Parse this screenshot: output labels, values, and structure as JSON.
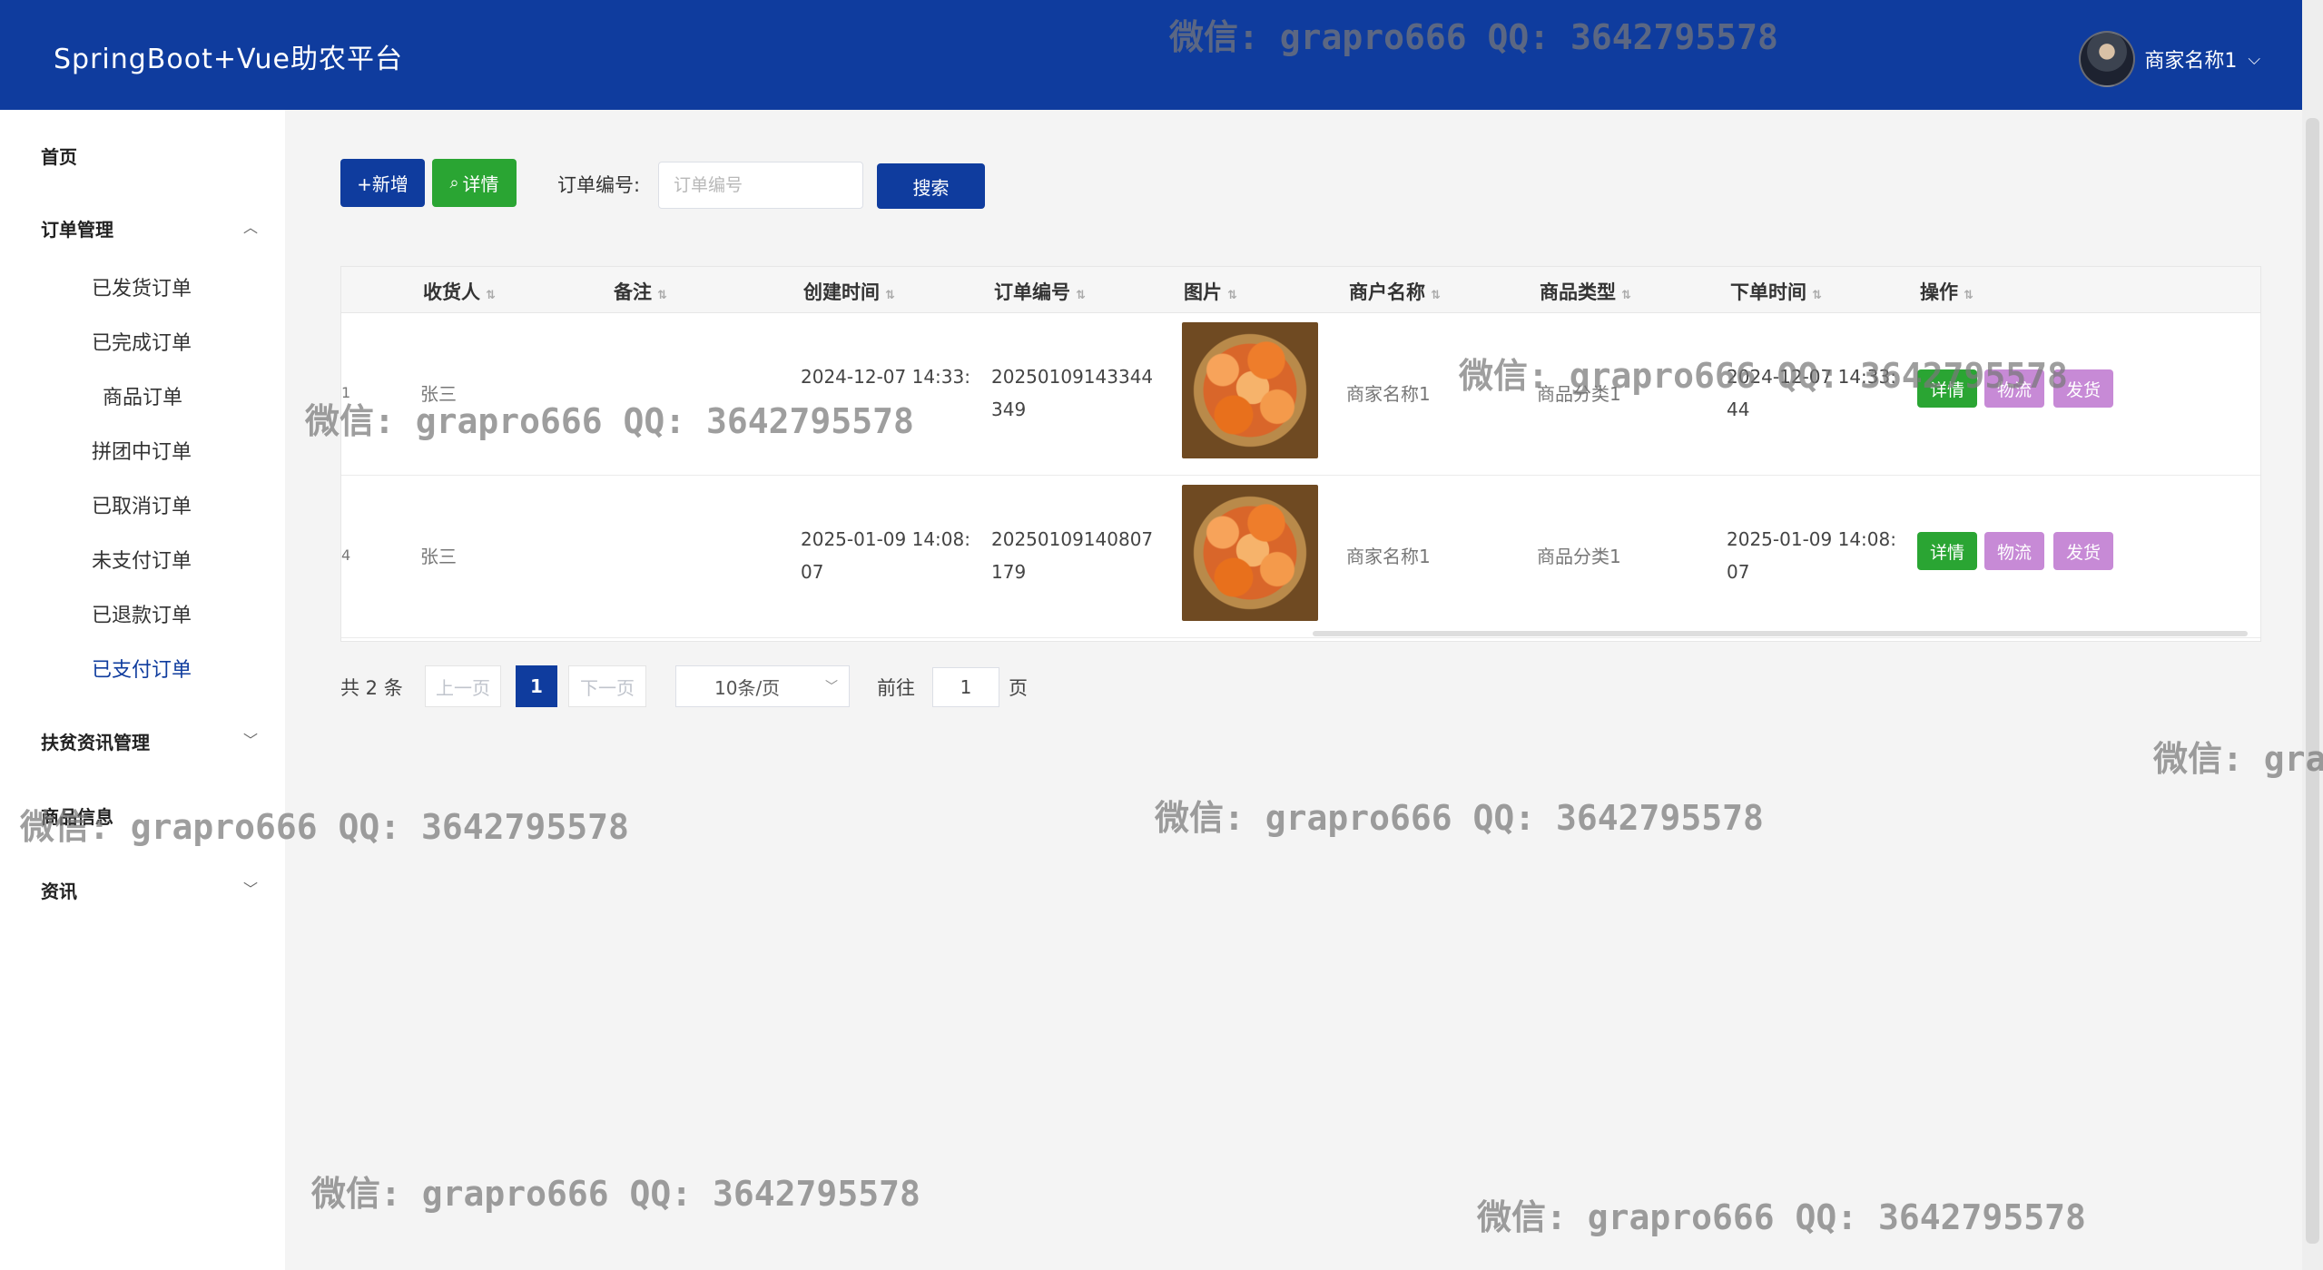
{
  "header": {
    "title": "SpringBoot+Vue助农平台",
    "user_name": "商家名称1"
  },
  "sidebar": {
    "home": "首页",
    "order_mgmt": "订单管理",
    "order_items": [
      "已发货订单",
      "已完成订单",
      "商品订单",
      "拼团中订单",
      "已取消订单",
      "未支付订单",
      "已退款订单",
      "已支付订单"
    ],
    "poverty_news": "扶贫资讯管理",
    "product_info": "商品信息",
    "news": "资讯"
  },
  "toolbar": {
    "add_label": "+新增",
    "detail_label": "详情",
    "order_no_label": "订单编号:",
    "order_no_placeholder": "订单编号",
    "search_label": "搜索"
  },
  "table": {
    "columns": [
      "收货人",
      "备注",
      "创建时间",
      "订单编号",
      "图片",
      "商户名称",
      "商品类型",
      "下单时间",
      "操作"
    ],
    "rows": [
      {
        "idx": "1",
        "receiver": "张三",
        "remark": "",
        "created": "2024-12-07 14:33:",
        "order_no": "20250109143344349",
        "merchant": "商家名称1",
        "category": "商品分类1",
        "order_time": "2024-12-07 14:33:44"
      },
      {
        "idx": "4",
        "receiver": "张三",
        "remark": "",
        "created": "2025-01-09 14:08:07",
        "order_no": "20250109140807179",
        "merchant": "商家名称1",
        "category": "商品分类1",
        "order_time": "2025-01-09 14:08:07"
      }
    ],
    "actions": {
      "detail": "详情",
      "logistics": "物流",
      "ship": "发货"
    }
  },
  "pagination": {
    "total": "共 2 条",
    "prev": "上一页",
    "current": "1",
    "next": "下一页",
    "page_size": "10条/页",
    "goto": "前往",
    "goto_value": "1",
    "page_unit": "页"
  },
  "watermark": "微信: grapro666 QQ: 3642795578",
  "colors": {
    "primary": "#0f3c9e",
    "success": "#2aa533",
    "purple": "#c78ad6"
  }
}
